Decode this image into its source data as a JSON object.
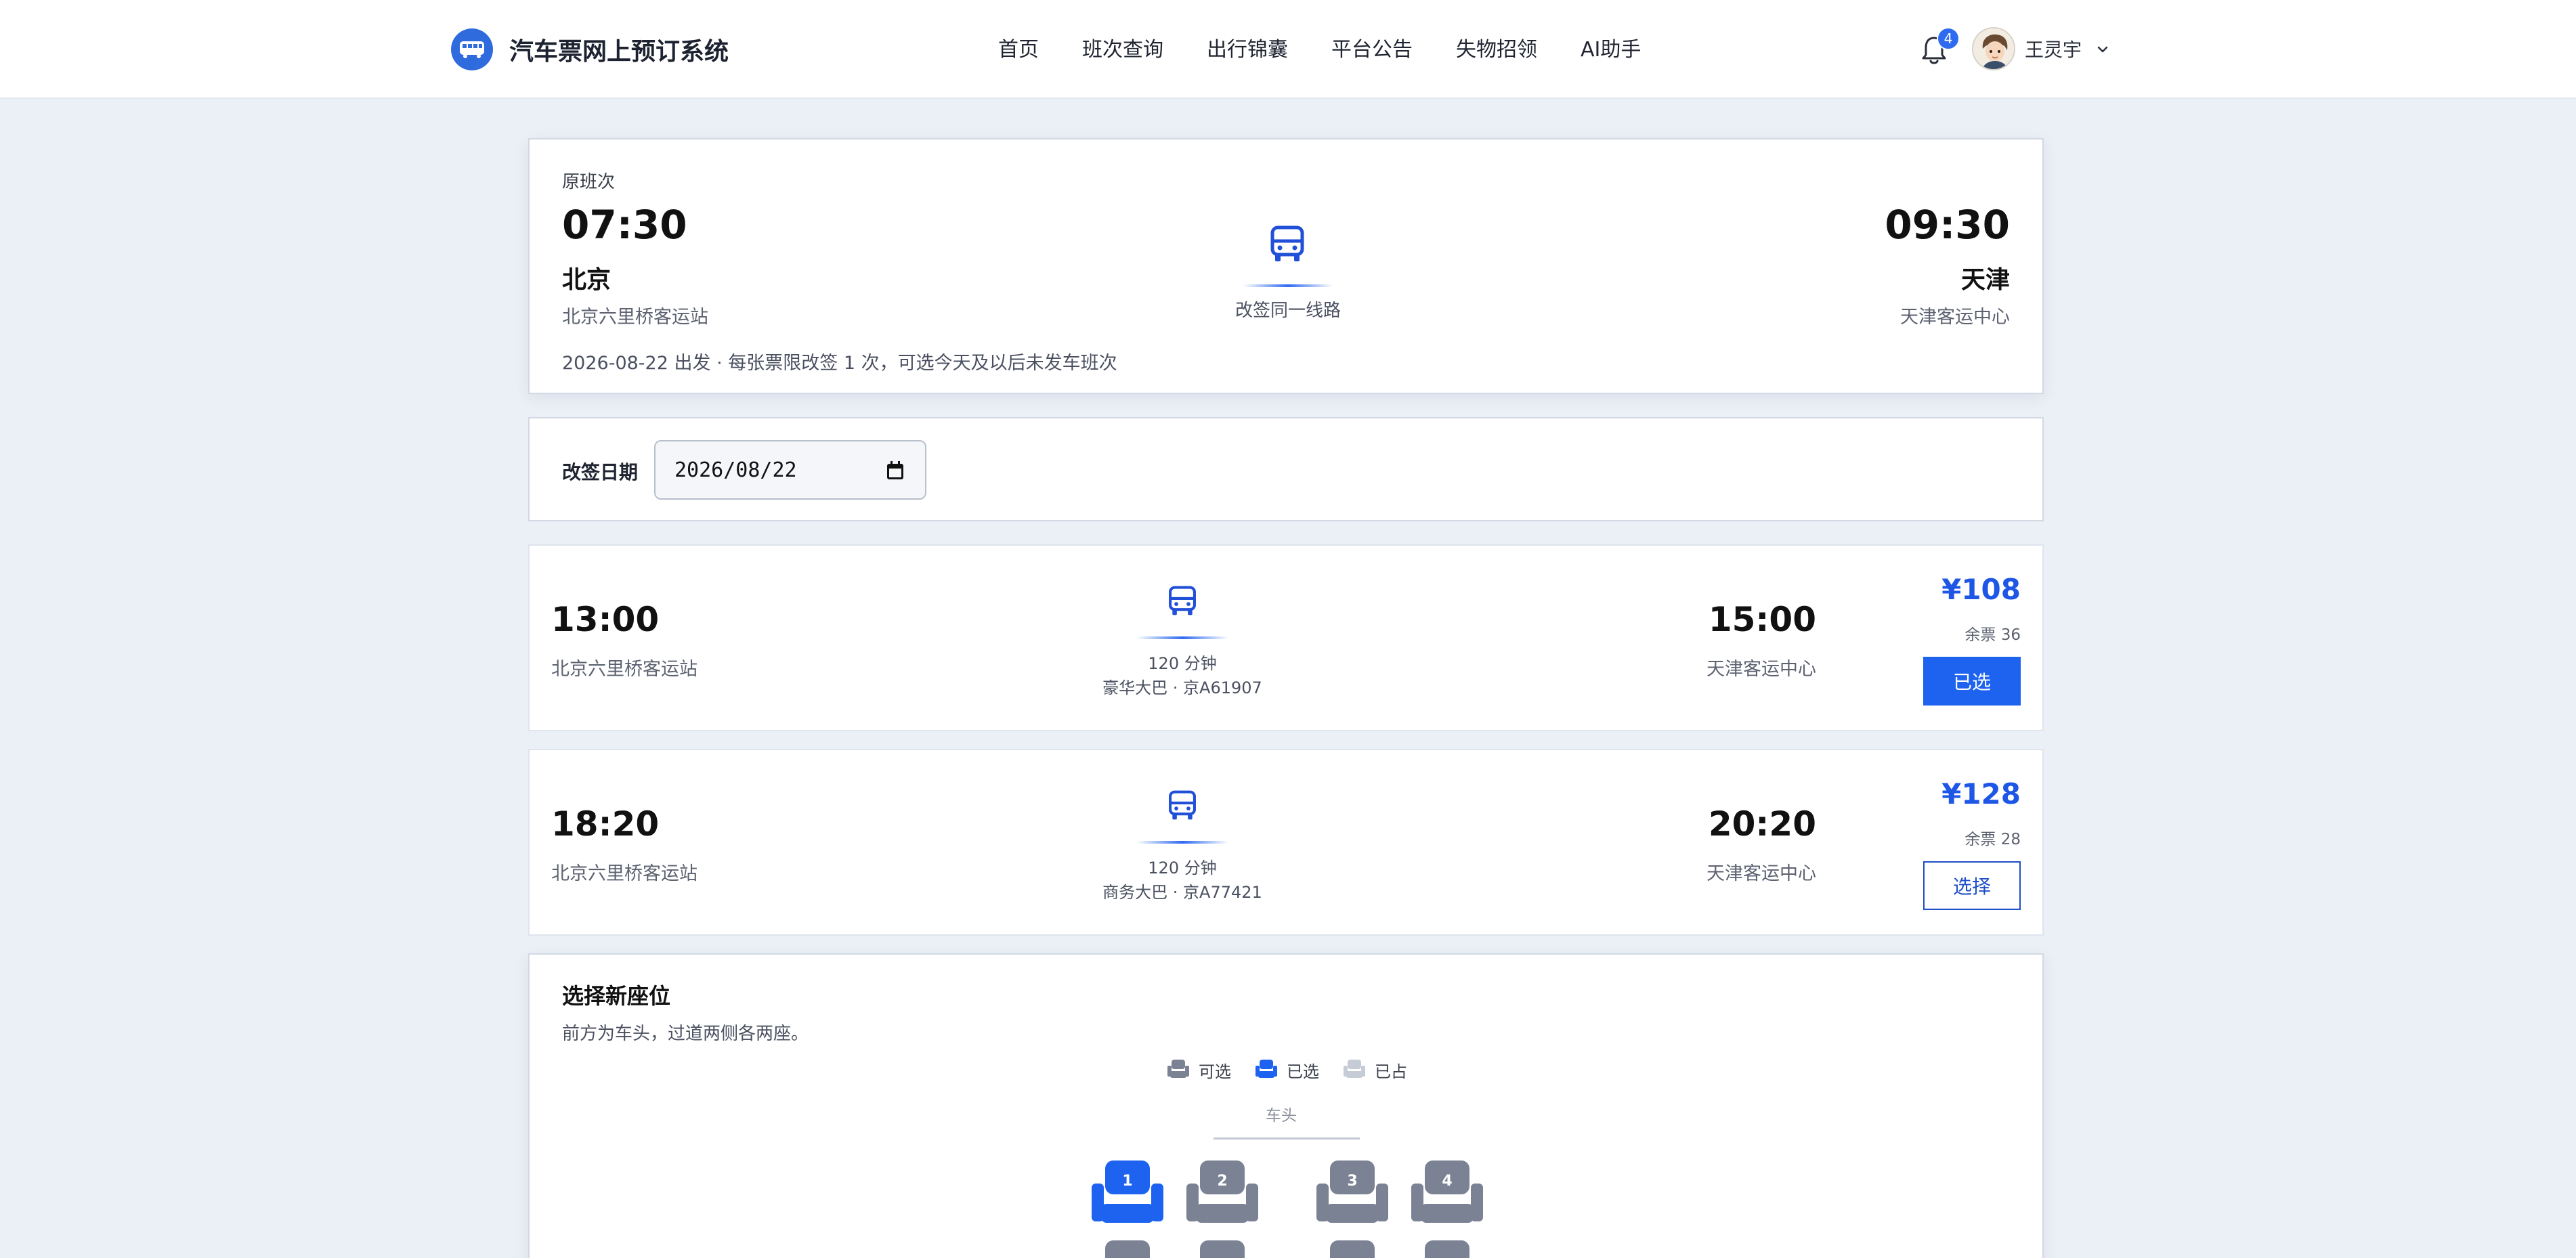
{
  "header": {
    "app_title": "汽车票网上预订系统",
    "nav": [
      "首页",
      "班次查询",
      "出行锦囊",
      "平台公告",
      "失物招领",
      "AI助手"
    ],
    "notification_count": "4",
    "username": "王灵宇"
  },
  "original": {
    "label": "原班次",
    "depart_time": "07:30",
    "depart_city": "北京",
    "depart_station": "北京六里桥客运站",
    "arrive_time": "09:30",
    "arrive_city": "天津",
    "arrive_station": "天津客运中心",
    "route_note": "改签同一线路",
    "note": "2026-08-22 出发 · 每张票限改签 1 次，可选今天及以后未发车班次"
  },
  "reschedule": {
    "date_label": "改签日期",
    "date_value": "2026/08/22"
  },
  "schedules": [
    {
      "depart_time": "13:00",
      "depart_station": "北京六里桥客运站",
      "duration": "120 分钟",
      "vehicle": "豪华大巴 · 京A61907",
      "arrive_time": "15:00",
      "arrive_station": "天津客运中心",
      "price": "¥108",
      "seats_left": "余票 36",
      "button": "已选"
    },
    {
      "depart_time": "18:20",
      "depart_station": "北京六里桥客运站",
      "duration": "120 分钟",
      "vehicle": "商务大巴 · 京A77421",
      "arrive_time": "20:20",
      "arrive_station": "天津客运中心",
      "price": "¥128",
      "seats_left": "余票 28",
      "button": "选择"
    }
  ],
  "seat_section": {
    "title": "选择新座位",
    "subtitle": "前方为车头，过道两侧各两座。",
    "legend": {
      "available": "可选",
      "selected": "已选",
      "occupied": "已占"
    },
    "front_label": "车头",
    "seats": [
      "1",
      "2",
      "3",
      "4"
    ]
  },
  "colors": {
    "accent": "#1e63f0",
    "seat_available": "#7a8294",
    "seat_occupied": "#c6ccd6",
    "background": "#ebeff6"
  }
}
